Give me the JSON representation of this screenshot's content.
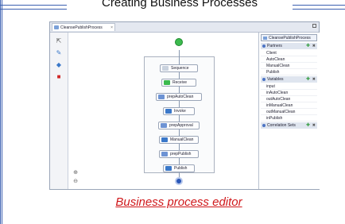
{
  "slide": {
    "title": "Creating Business Processes",
    "caption": "Business process editor"
  },
  "editor": {
    "tab_label": "CleansePublishProcess",
    "tab_close": "×",
    "palette": [
      {
        "icon": "pointer-icon",
        "glyph": "⇱",
        "color": "#555555"
      },
      {
        "icon": "pencil-icon",
        "glyph": "✎",
        "color": "#3a78c9"
      },
      {
        "icon": "diamond-icon",
        "glyph": "◆",
        "color": "#3a78c9"
      },
      {
        "icon": "stop-icon",
        "glyph": "■",
        "color": "#d02626"
      }
    ],
    "zoom_in": "⊕",
    "zoom_out": "⊖",
    "nodes": [
      {
        "label": "Sequence",
        "icon_color": "#c9d2de"
      },
      {
        "label": "Receive",
        "icon_color": "#3cba4e"
      },
      {
        "label": "prepAutoClean",
        "icon_color": "#6d93d4"
      },
      {
        "label": "Invoke",
        "icon_color": "#3a78c9"
      },
      {
        "label": "prepApproval",
        "icon_color": "#6d93d4"
      },
      {
        "label": "ManualClean",
        "icon_color": "#3a78c9"
      },
      {
        "label": "prepPublish",
        "icon_color": "#6d93d4"
      },
      {
        "label": "Publish",
        "icon_color": "#3a78c9"
      }
    ]
  },
  "outline": {
    "process_name": "CleansePublishProcess",
    "sections": [
      {
        "title": "Partners",
        "add": "✚",
        "del": "✖",
        "items": [
          "Client",
          "AutoClean",
          "ManualClean",
          "Publish"
        ]
      },
      {
        "title": "Variables",
        "add": "✚",
        "del": "✖",
        "items": [
          "input",
          "inAutoClean",
          "outAutoClean",
          "inManualClean",
          "outManualClean",
          "inPublish"
        ]
      },
      {
        "title": "Correlation Sets",
        "add": "✚",
        "del": "✖",
        "items": []
      }
    ]
  }
}
